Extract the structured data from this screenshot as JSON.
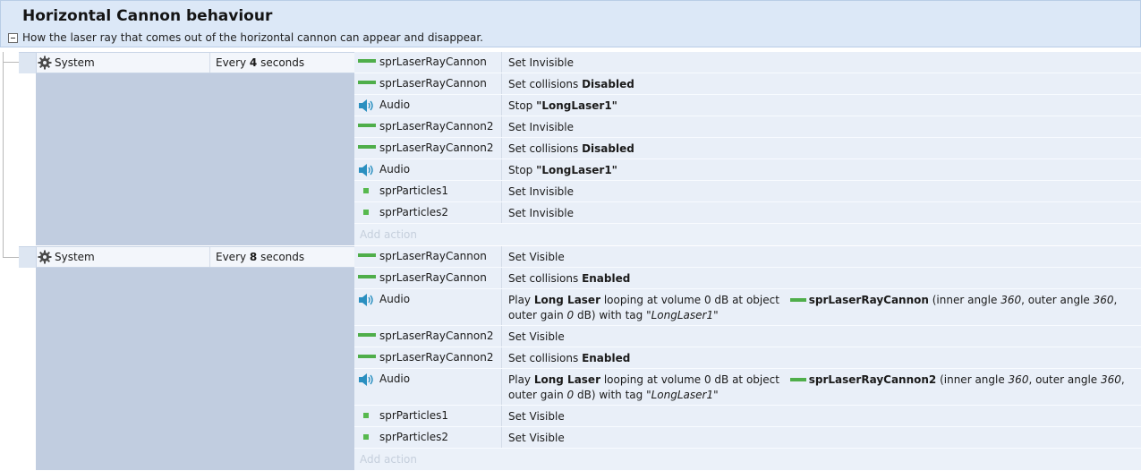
{
  "group": {
    "title": "Horizontal Cannon behaviour",
    "description": "How the laser ray that comes out of the horizontal cannon can appear and disappear."
  },
  "events": [
    {
      "condition": {
        "object": "System",
        "pre": "Every ",
        "value": "4",
        "post": " seconds"
      },
      "actions": [
        {
          "icon": "sprite",
          "object": "sprLaserRayCannon",
          "parts": [
            {
              "t": "Set Invisible"
            }
          ]
        },
        {
          "icon": "sprite",
          "object": "sprLaserRayCannon",
          "parts": [
            {
              "t": "Set collisions "
            },
            {
              "t": "Disabled",
              "b": true
            }
          ]
        },
        {
          "icon": "audio",
          "object": "Audio",
          "parts": [
            {
              "t": "Stop "
            },
            {
              "t": "\"LongLaser1\"",
              "b": true
            }
          ]
        },
        {
          "icon": "sprite",
          "object": "sprLaserRayCannon2",
          "parts": [
            {
              "t": "Set Invisible"
            }
          ]
        },
        {
          "icon": "sprite",
          "object": "sprLaserRayCannon2",
          "parts": [
            {
              "t": "Set collisions "
            },
            {
              "t": "Disabled",
              "b": true
            }
          ]
        },
        {
          "icon": "audio",
          "object": "Audio",
          "parts": [
            {
              "t": "Stop "
            },
            {
              "t": "\"LongLaser1\"",
              "b": true
            }
          ]
        },
        {
          "icon": "particle",
          "object": "sprParticles1",
          "parts": [
            {
              "t": "Set Invisible"
            }
          ]
        },
        {
          "icon": "particle",
          "object": "sprParticles2",
          "parts": [
            {
              "t": "Set Invisible"
            }
          ]
        }
      ],
      "add_action": "Add action"
    },
    {
      "condition": {
        "object": "System",
        "pre": "Every ",
        "value": "8",
        "post": " seconds"
      },
      "actions": [
        {
          "icon": "sprite",
          "object": "sprLaserRayCannon",
          "parts": [
            {
              "t": "Set Visible"
            }
          ]
        },
        {
          "icon": "sprite",
          "object": "sprLaserRayCannon",
          "parts": [
            {
              "t": "Set collisions "
            },
            {
              "t": "Enabled",
              "b": true
            }
          ]
        },
        {
          "icon": "audio",
          "object": "Audio",
          "tall": true,
          "parts": [
            {
              "t": "Play "
            },
            {
              "t": "Long Laser",
              "b": true
            },
            {
              "t": " looping at volume 0 dB at object "
            },
            {
              "icon": "sprite"
            },
            {
              "t": "sprLaserRayCannon",
              "b": true
            },
            {
              "t": " (inner angle "
            },
            {
              "t": "360",
              "i": true
            },
            {
              "t": ", outer angle "
            },
            {
              "t": "360",
              "i": true
            },
            {
              "t": ", outer gain "
            },
            {
              "t": "0",
              "i": true
            },
            {
              "t": " dB) with tag "
            },
            {
              "t": "\"LongLaser1\"",
              "i": true
            }
          ]
        },
        {
          "icon": "sprite",
          "object": "sprLaserRayCannon2",
          "parts": [
            {
              "t": "Set Visible"
            }
          ]
        },
        {
          "icon": "sprite",
          "object": "sprLaserRayCannon2",
          "parts": [
            {
              "t": "Set collisions "
            },
            {
              "t": "Enabled",
              "b": true
            }
          ]
        },
        {
          "icon": "audio",
          "object": "Audio",
          "tall": true,
          "parts": [
            {
              "t": "Play "
            },
            {
              "t": "Long Laser",
              "b": true
            },
            {
              "t": " looping at volume 0 dB at object "
            },
            {
              "icon": "sprite"
            },
            {
              "t": "sprLaserRayCannon2",
              "b": true
            },
            {
              "t": " (inner angle "
            },
            {
              "t": "360",
              "i": true
            },
            {
              "t": ", outer angle "
            },
            {
              "t": "360",
              "i": true
            },
            {
              "t": ", outer gain "
            },
            {
              "t": "0",
              "i": true
            },
            {
              "t": " dB) with tag "
            },
            {
              "t": "\"LongLaser1\"",
              "i": true
            }
          ]
        },
        {
          "icon": "particle",
          "object": "sprParticles1",
          "parts": [
            {
              "t": "Set Visible"
            }
          ]
        },
        {
          "icon": "particle",
          "object": "sprParticles2",
          "parts": [
            {
              "t": "Set Visible"
            }
          ]
        }
      ],
      "add_action": "Add action"
    }
  ],
  "colors": {
    "header_bg": "#dce8f7",
    "condition_bg": "#c1cde0",
    "action_bg": "#e9eff8",
    "sprite_icon": "#4fae4a",
    "audio_icon": "#2a8fc0"
  }
}
